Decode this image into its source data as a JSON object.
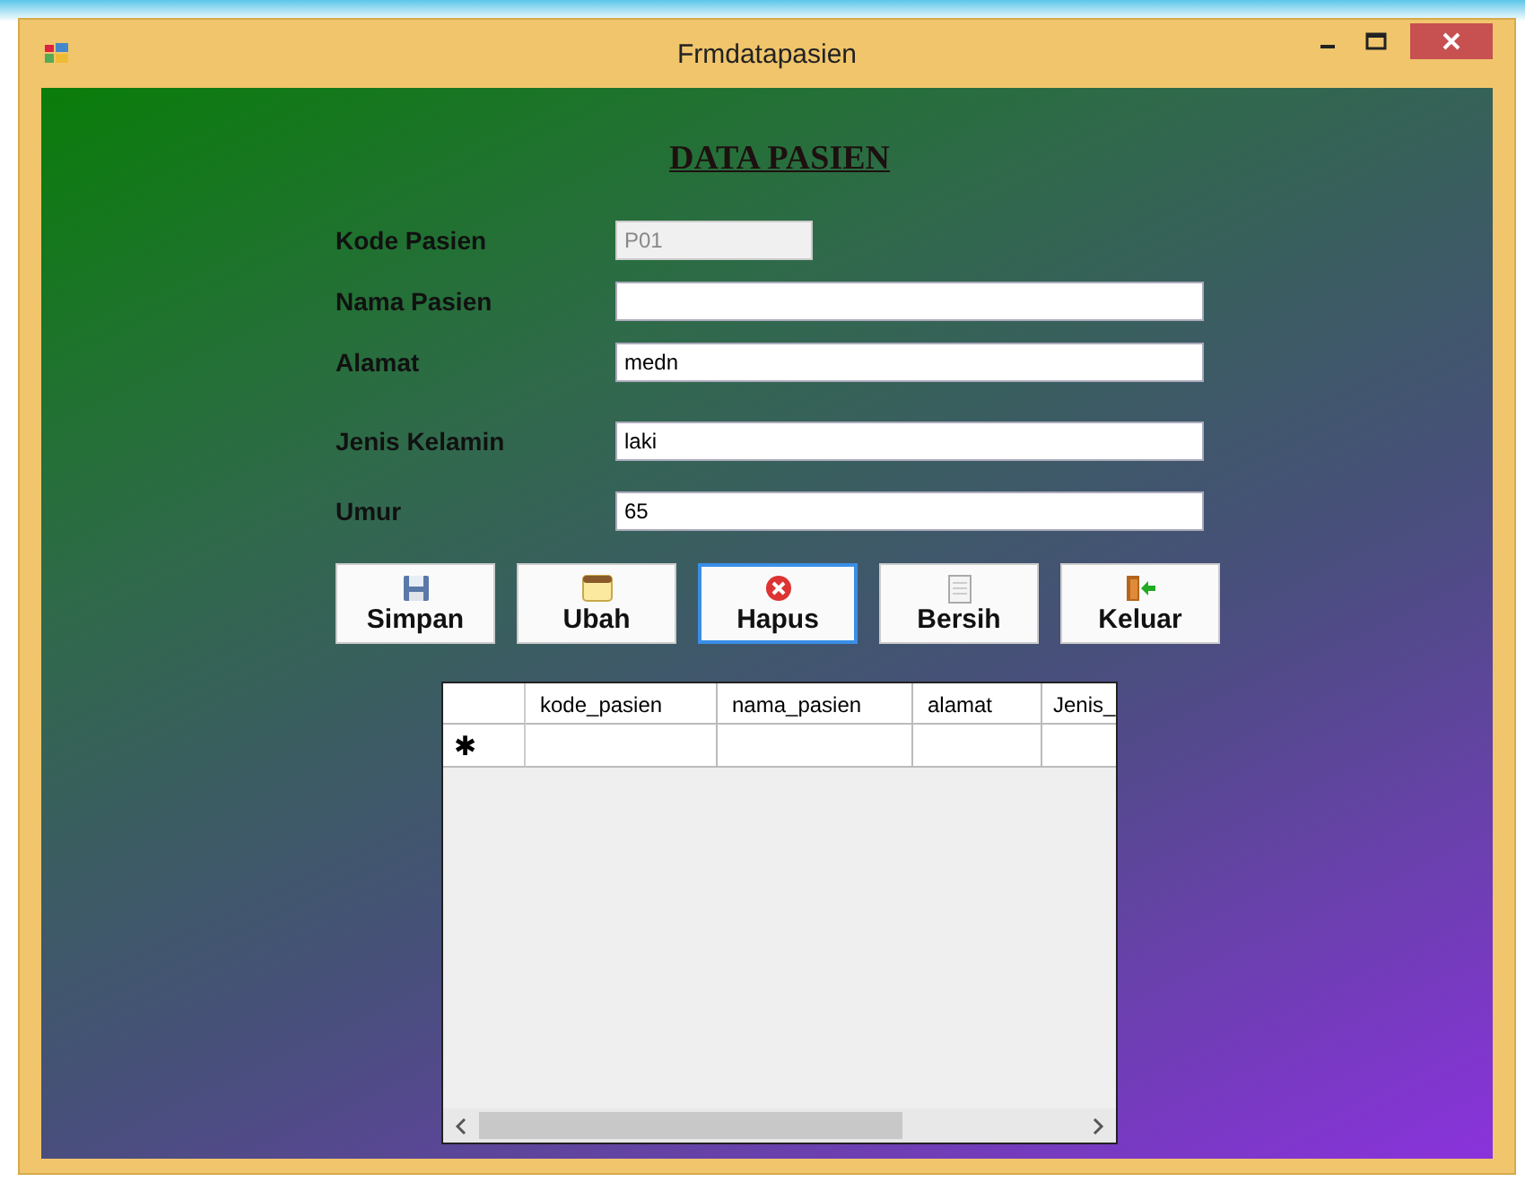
{
  "window": {
    "title": "Frmdatapasien"
  },
  "heading": "DATA PASIEN",
  "fields": [
    {
      "label": "Kode Pasien",
      "value": "P01",
      "disabled": true
    },
    {
      "label": "Nama Pasien",
      "disabled": false
    },
    {
      "label": "Alamat",
      "value": "medn",
      "disabled": false
    },
    {
      "label": "Jenis Kelamin",
      "value": "laki",
      "disabled": false
    },
    {
      "label": "Umur",
      "value": "65",
      "disabled": false
    }
  ],
  "buttons": [
    {
      "label": "Simpan",
      "kind": "save",
      "focused": false
    },
    {
      "label": "Ubah",
      "kind": "edit",
      "focused": false
    },
    {
      "label": "Hapus",
      "kind": "delete",
      "focused": true
    },
    {
      "label": "Bersih",
      "kind": "clear",
      "focused": false
    },
    {
      "label": "Keluar",
      "kind": "exit",
      "focused": false
    }
  ],
  "table": {
    "columns": [
      "kode_pasien",
      "nama_pasien",
      "alamat",
      "Jenis_"
    ],
    "new_row_marker": "✱"
  }
}
